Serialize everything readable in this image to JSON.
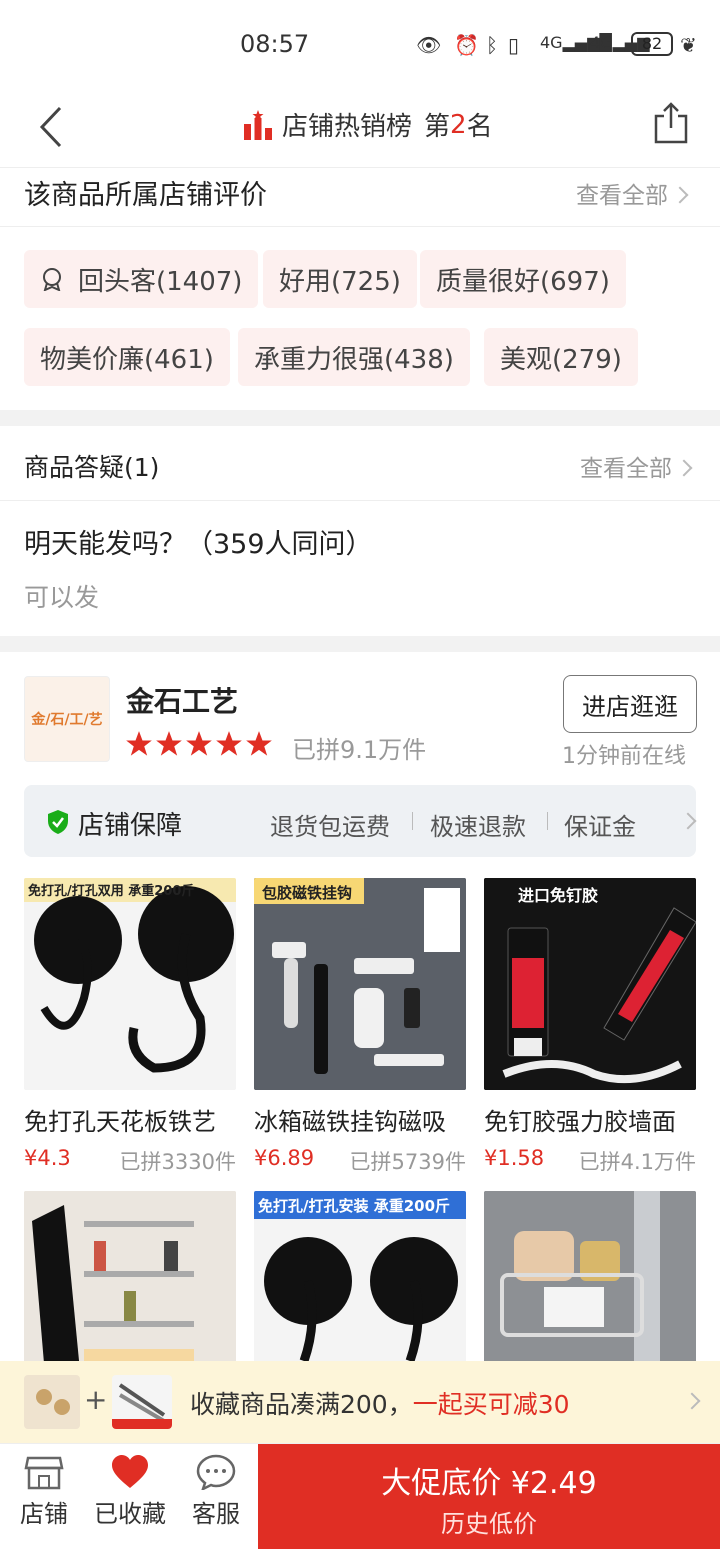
{
  "status_bar": {
    "time": "08:57",
    "battery": "82"
  },
  "header": {
    "rank_label": "店铺热销榜",
    "rank_prefix": "第",
    "rank_number": "2",
    "rank_suffix": "名"
  },
  "reviews": {
    "title": "该商品所属店铺评价",
    "view_all": "查看全部",
    "tags": [
      "回头客(1407)",
      "好用(725)",
      "质量很好(697)",
      "物美价廉(461)",
      "承重力很强(438)",
      "美观(279)"
    ]
  },
  "qa": {
    "title": "商品答疑(1)",
    "view_all": "查看全部",
    "question": "明天能发吗？（359人同问）",
    "answer": "可以发"
  },
  "store": {
    "logo_text": "金/石/工/艺",
    "name": "金石工艺",
    "rating_stars": 5,
    "sold": "已拼9.1万件",
    "enter_button": "进店逛逛",
    "online_status": "1分钟前在线",
    "guarantee_title": "店铺保障",
    "guarantee_items": [
      "退货包运费",
      "极速退款",
      "保证金"
    ]
  },
  "products": [
    {
      "name": "免打孔天花板铁艺",
      "price": "¥4.3",
      "sold": "已拼3330件",
      "banner": "免打孔/打孔双用  承重200斤"
    },
    {
      "name": "冰箱磁铁挂钩磁吸",
      "price": "¥6.89",
      "sold": "已拼5739件",
      "banner": "包胶磁铁挂钩"
    },
    {
      "name": "免钉胶强力胶墙面",
      "price": "¥1.58",
      "sold": "已拼4.1万件",
      "banner": "进口免钉胶"
    },
    {
      "name": "",
      "price": "",
      "sold": "",
      "banner": ""
    },
    {
      "name": "",
      "price": "",
      "sold": "",
      "banner": "免打孔/打孔安装  承重200斤"
    },
    {
      "name": "",
      "price": "",
      "sold": "",
      "banner": ""
    }
  ],
  "promo": {
    "text": "收藏商品凑满200，",
    "highlight": "一起买可减30"
  },
  "bottom_bar": {
    "store_label": "店铺",
    "favorited_label": "已收藏",
    "service_label": "客服",
    "buy_main": "大促底价 ¥2.49",
    "buy_sub": "历史低价"
  },
  "colors": {
    "accent": "#e02e24",
    "tag_bg": "#fdf0ef",
    "promo_bg": "#fdf5d9"
  }
}
